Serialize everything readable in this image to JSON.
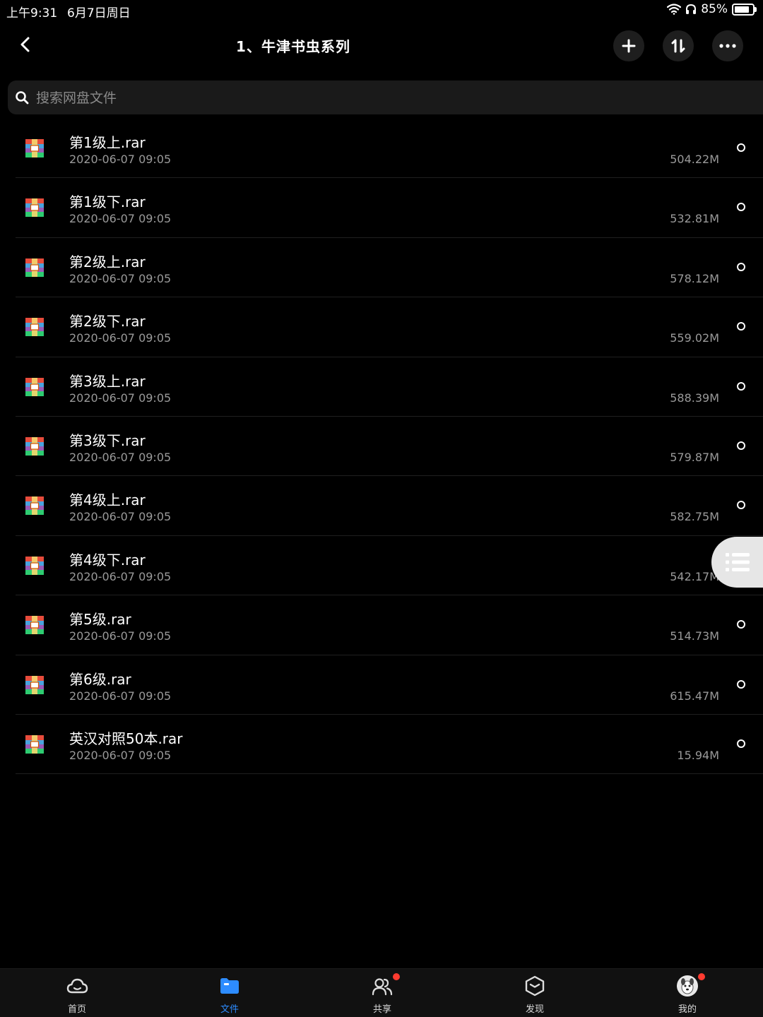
{
  "status_bar": {
    "time": "上午9:31",
    "date": "6月7日周日",
    "battery_percent": "85%",
    "battery_level": 0.85
  },
  "header": {
    "title": "1、牛津书虫系列"
  },
  "search": {
    "placeholder": "搜索网盘文件"
  },
  "files": [
    {
      "name": "第1级上.rar",
      "date": "2020-06-07 09:05",
      "size": "504.22M"
    },
    {
      "name": "第1级下.rar",
      "date": "2020-06-07 09:05",
      "size": "532.81M"
    },
    {
      "name": "第2级上.rar",
      "date": "2020-06-07 09:05",
      "size": "578.12M"
    },
    {
      "name": "第2级下.rar",
      "date": "2020-06-07 09:05",
      "size": "559.02M"
    },
    {
      "name": "第3级上.rar",
      "date": "2020-06-07 09:05",
      "size": "588.39M"
    },
    {
      "name": "第3级下.rar",
      "date": "2020-06-07 09:05",
      "size": "579.87M"
    },
    {
      "name": "第4级上.rar",
      "date": "2020-06-07 09:05",
      "size": "582.75M"
    },
    {
      "name": "第4级下.rar",
      "date": "2020-06-07 09:05",
      "size": "542.17M"
    },
    {
      "name": "第5级.rar",
      "date": "2020-06-07 09:05",
      "size": "514.73M"
    },
    {
      "name": "第6级.rar",
      "date": "2020-06-07 09:05",
      "size": "615.47M"
    },
    {
      "name": "英汉对照50本.rar",
      "date": "2020-06-07 09:05",
      "size": "15.94M"
    }
  ],
  "tabs": [
    {
      "label": "首页",
      "icon": "cloud-icon"
    },
    {
      "label": "文件",
      "icon": "folder-icon"
    },
    {
      "label": "共享",
      "icon": "people-icon"
    },
    {
      "label": "发现",
      "icon": "cube-icon"
    },
    {
      "label": "我的",
      "icon": "avatar-icon"
    }
  ],
  "colors": {
    "accent": "#2d8cff",
    "badge": "#ff3b30",
    "background": "#000000"
  }
}
